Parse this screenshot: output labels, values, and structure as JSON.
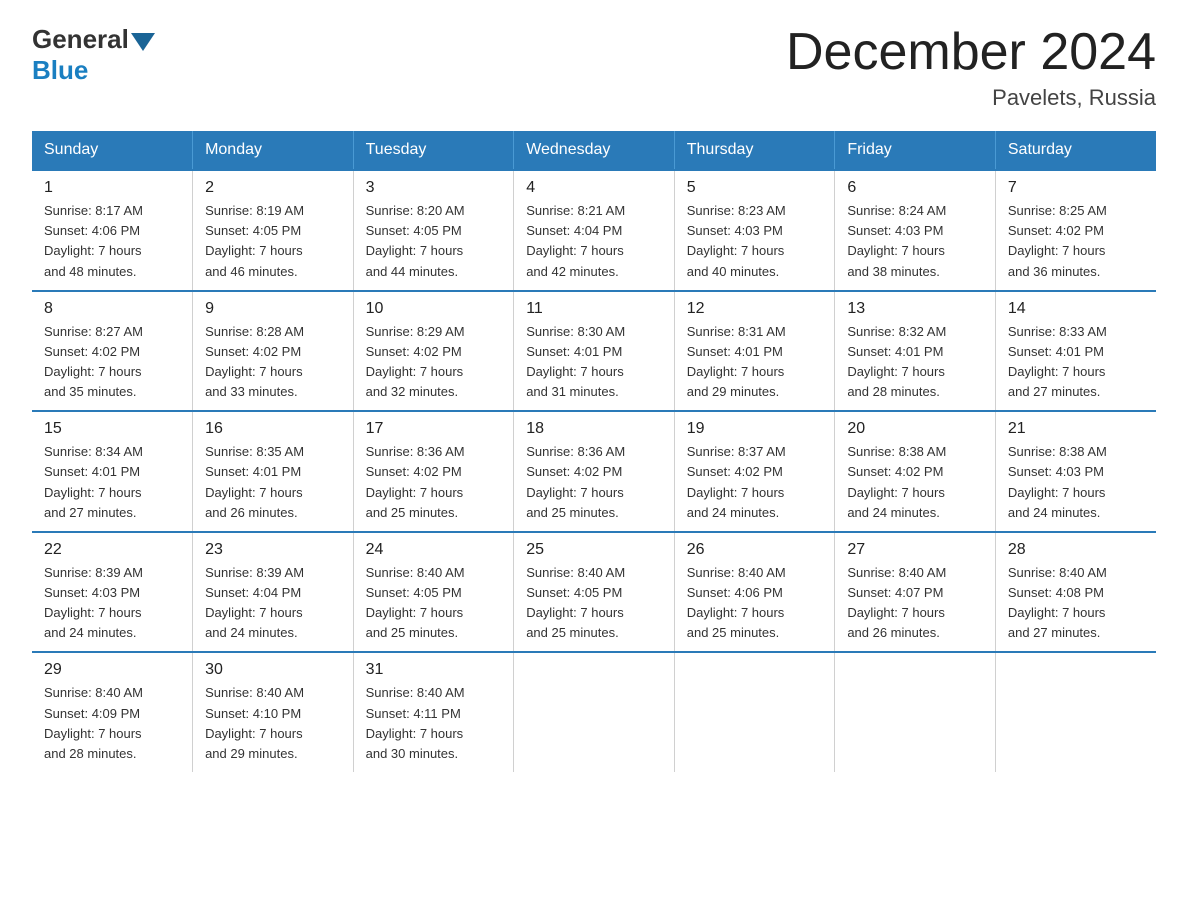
{
  "logo": {
    "general": "General",
    "blue": "Blue"
  },
  "title": "December 2024",
  "location": "Pavelets, Russia",
  "headers": [
    "Sunday",
    "Monday",
    "Tuesday",
    "Wednesday",
    "Thursday",
    "Friday",
    "Saturday"
  ],
  "weeks": [
    [
      {
        "day": "1",
        "sunrise": "8:17 AM",
        "sunset": "4:06 PM",
        "daylight": "7 hours and 48 minutes."
      },
      {
        "day": "2",
        "sunrise": "8:19 AM",
        "sunset": "4:05 PM",
        "daylight": "7 hours and 46 minutes."
      },
      {
        "day": "3",
        "sunrise": "8:20 AM",
        "sunset": "4:05 PM",
        "daylight": "7 hours and 44 minutes."
      },
      {
        "day": "4",
        "sunrise": "8:21 AM",
        "sunset": "4:04 PM",
        "daylight": "7 hours and 42 minutes."
      },
      {
        "day": "5",
        "sunrise": "8:23 AM",
        "sunset": "4:03 PM",
        "daylight": "7 hours and 40 minutes."
      },
      {
        "day": "6",
        "sunrise": "8:24 AM",
        "sunset": "4:03 PM",
        "daylight": "7 hours and 38 minutes."
      },
      {
        "day": "7",
        "sunrise": "8:25 AM",
        "sunset": "4:02 PM",
        "daylight": "7 hours and 36 minutes."
      }
    ],
    [
      {
        "day": "8",
        "sunrise": "8:27 AM",
        "sunset": "4:02 PM",
        "daylight": "7 hours and 35 minutes."
      },
      {
        "day": "9",
        "sunrise": "8:28 AM",
        "sunset": "4:02 PM",
        "daylight": "7 hours and 33 minutes."
      },
      {
        "day": "10",
        "sunrise": "8:29 AM",
        "sunset": "4:02 PM",
        "daylight": "7 hours and 32 minutes."
      },
      {
        "day": "11",
        "sunrise": "8:30 AM",
        "sunset": "4:01 PM",
        "daylight": "7 hours and 31 minutes."
      },
      {
        "day": "12",
        "sunrise": "8:31 AM",
        "sunset": "4:01 PM",
        "daylight": "7 hours and 29 minutes."
      },
      {
        "day": "13",
        "sunrise": "8:32 AM",
        "sunset": "4:01 PM",
        "daylight": "7 hours and 28 minutes."
      },
      {
        "day": "14",
        "sunrise": "8:33 AM",
        "sunset": "4:01 PM",
        "daylight": "7 hours and 27 minutes."
      }
    ],
    [
      {
        "day": "15",
        "sunrise": "8:34 AM",
        "sunset": "4:01 PM",
        "daylight": "7 hours and 27 minutes."
      },
      {
        "day": "16",
        "sunrise": "8:35 AM",
        "sunset": "4:01 PM",
        "daylight": "7 hours and 26 minutes."
      },
      {
        "day": "17",
        "sunrise": "8:36 AM",
        "sunset": "4:02 PM",
        "daylight": "7 hours and 25 minutes."
      },
      {
        "day": "18",
        "sunrise": "8:36 AM",
        "sunset": "4:02 PM",
        "daylight": "7 hours and 25 minutes."
      },
      {
        "day": "19",
        "sunrise": "8:37 AM",
        "sunset": "4:02 PM",
        "daylight": "7 hours and 24 minutes."
      },
      {
        "day": "20",
        "sunrise": "8:38 AM",
        "sunset": "4:02 PM",
        "daylight": "7 hours and 24 minutes."
      },
      {
        "day": "21",
        "sunrise": "8:38 AM",
        "sunset": "4:03 PM",
        "daylight": "7 hours and 24 minutes."
      }
    ],
    [
      {
        "day": "22",
        "sunrise": "8:39 AM",
        "sunset": "4:03 PM",
        "daylight": "7 hours and 24 minutes."
      },
      {
        "day": "23",
        "sunrise": "8:39 AM",
        "sunset": "4:04 PM",
        "daylight": "7 hours and 24 minutes."
      },
      {
        "day": "24",
        "sunrise": "8:40 AM",
        "sunset": "4:05 PM",
        "daylight": "7 hours and 25 minutes."
      },
      {
        "day": "25",
        "sunrise": "8:40 AM",
        "sunset": "4:05 PM",
        "daylight": "7 hours and 25 minutes."
      },
      {
        "day": "26",
        "sunrise": "8:40 AM",
        "sunset": "4:06 PM",
        "daylight": "7 hours and 25 minutes."
      },
      {
        "day": "27",
        "sunrise": "8:40 AM",
        "sunset": "4:07 PM",
        "daylight": "7 hours and 26 minutes."
      },
      {
        "day": "28",
        "sunrise": "8:40 AM",
        "sunset": "4:08 PM",
        "daylight": "7 hours and 27 minutes."
      }
    ],
    [
      {
        "day": "29",
        "sunrise": "8:40 AM",
        "sunset": "4:09 PM",
        "daylight": "7 hours and 28 minutes."
      },
      {
        "day": "30",
        "sunrise": "8:40 AM",
        "sunset": "4:10 PM",
        "daylight": "7 hours and 29 minutes."
      },
      {
        "day": "31",
        "sunrise": "8:40 AM",
        "sunset": "4:11 PM",
        "daylight": "7 hours and 30 minutes."
      },
      null,
      null,
      null,
      null
    ]
  ],
  "sunrise_label": "Sunrise:",
  "sunset_label": "Sunset:",
  "daylight_label": "Daylight:"
}
